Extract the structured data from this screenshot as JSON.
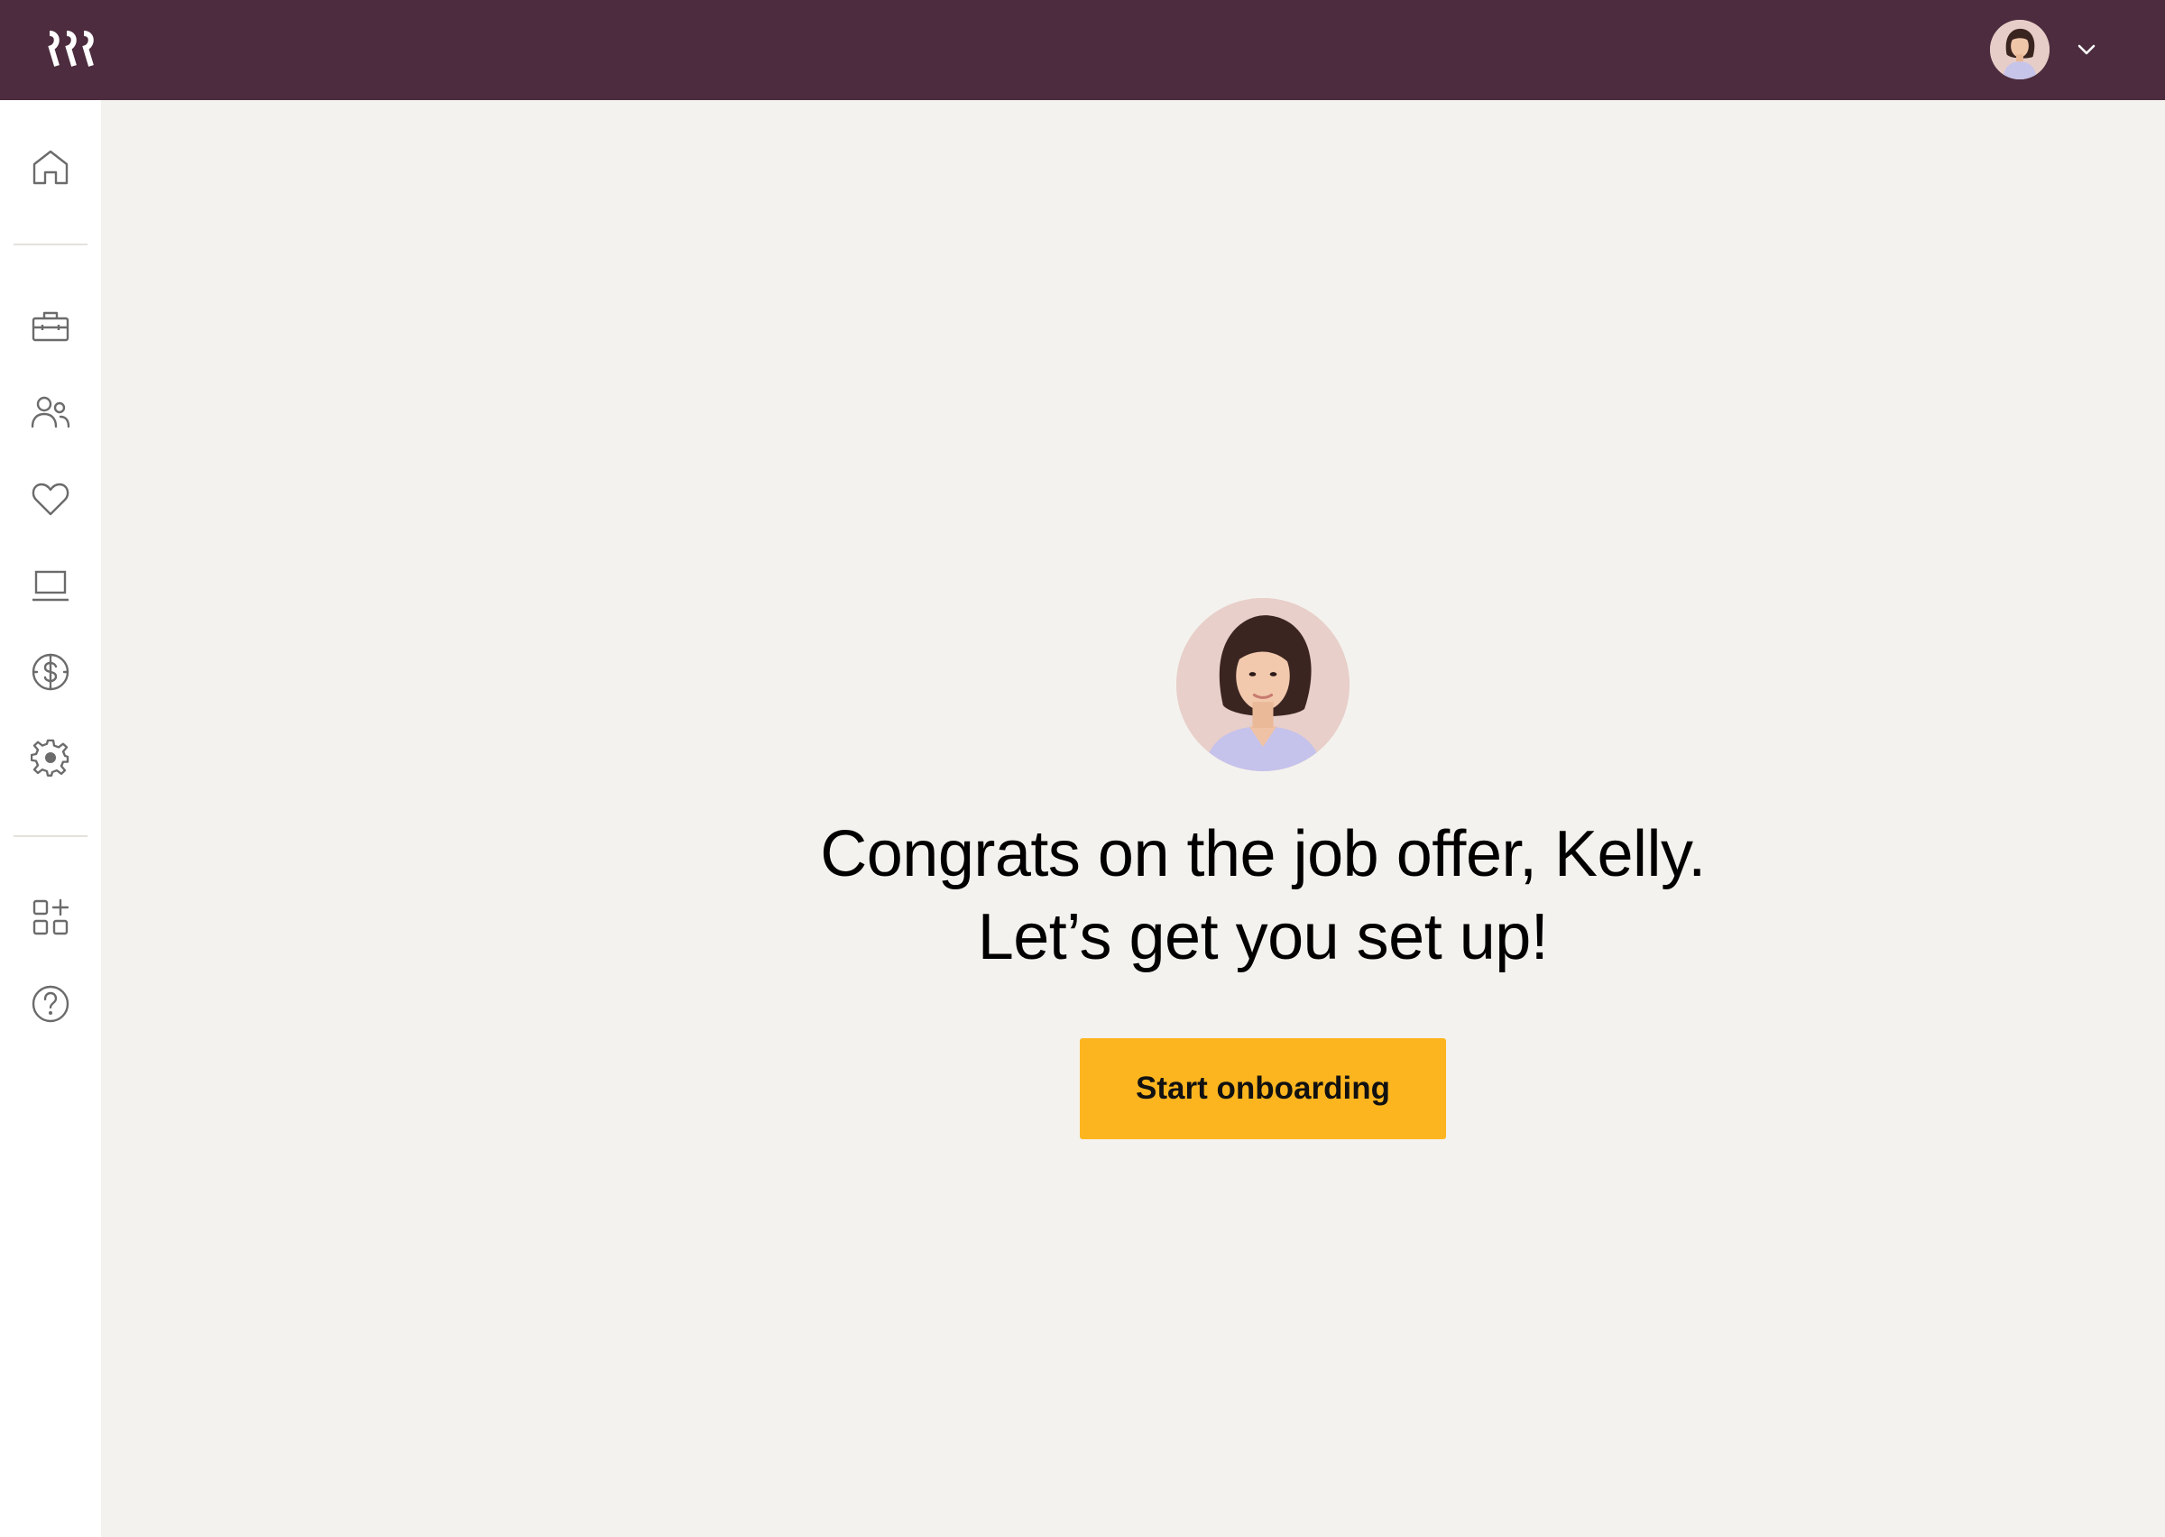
{
  "app": {
    "logo_icon": "rippling-logo-icon",
    "brand_color": "#4c2c3e",
    "accent_color": "#fdb51f"
  },
  "header": {
    "account_avatar_icon": "user-avatar",
    "account_menu_icon": "chevron-down-icon"
  },
  "sidebar": {
    "items": [
      {
        "name": "home",
        "icon": "home-icon"
      },
      {
        "name": "hr",
        "icon": "briefcase-icon"
      },
      {
        "name": "people",
        "icon": "people-icon"
      },
      {
        "name": "benefits",
        "icon": "heart-icon"
      },
      {
        "name": "devices",
        "icon": "laptop-icon"
      },
      {
        "name": "payroll",
        "icon": "dollar-icon"
      },
      {
        "name": "settings",
        "icon": "gear-icon"
      },
      {
        "name": "apps",
        "icon": "apps-add-icon"
      },
      {
        "name": "help",
        "icon": "help-icon"
      }
    ]
  },
  "main": {
    "headline_line1": "Congrats on the job offer, Kelly.",
    "headline_line2": "Let’s get you set up!",
    "cta_label": "Start onboarding"
  }
}
